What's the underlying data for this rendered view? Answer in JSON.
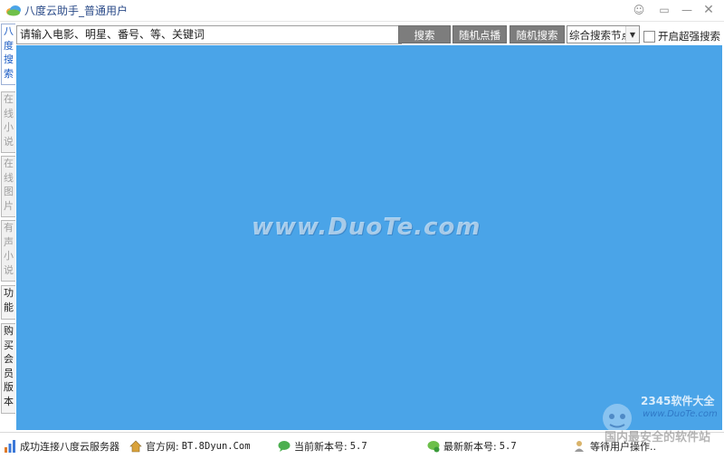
{
  "window": {
    "title": "八度云助手_普通用户",
    "controls": {
      "feedback": "☺",
      "restore": "▭",
      "minimize": "—",
      "close": "✕"
    }
  },
  "side_tabs": [
    {
      "label": [
        "八",
        "度",
        "搜",
        "索"
      ]
    },
    {
      "label": [
        "在",
        "线",
        "小",
        "说"
      ]
    },
    {
      "label": [
        "在",
        "线",
        "图",
        "片"
      ]
    },
    {
      "label": [
        "有",
        "声",
        "小",
        "说"
      ]
    },
    {
      "label": [
        "功",
        "能"
      ]
    },
    {
      "label": [
        "购",
        "买",
        "会",
        "员",
        "版",
        "本"
      ]
    }
  ],
  "search": {
    "input_value": "请输入电影、明星、番号、等、关键词",
    "search_button": "搜索",
    "random_play_button": "随机点播",
    "random_search_button": "随机搜索",
    "node_select_value": "综合搜索节点",
    "super_search_label": "开启超强搜索"
  },
  "content": {
    "background": "#4aa4e8",
    "watermark_center": "www.DuoTe.com",
    "watermark_logo_brand": "2345软件大全",
    "watermark_logo_url": "www.DuoTe.com",
    "watermark_bottom": "国内最安全的软件站"
  },
  "statusbar": {
    "connection": "成功连接八度云服务器",
    "site_label": "官方网:",
    "site_url": "BT.8Dyun.Com",
    "current_version_label": "当前新本号:",
    "current_version": "5.7",
    "latest_version_label": "最新新本号:",
    "latest_version": "5.7",
    "waiting": "等待用户操作.."
  }
}
